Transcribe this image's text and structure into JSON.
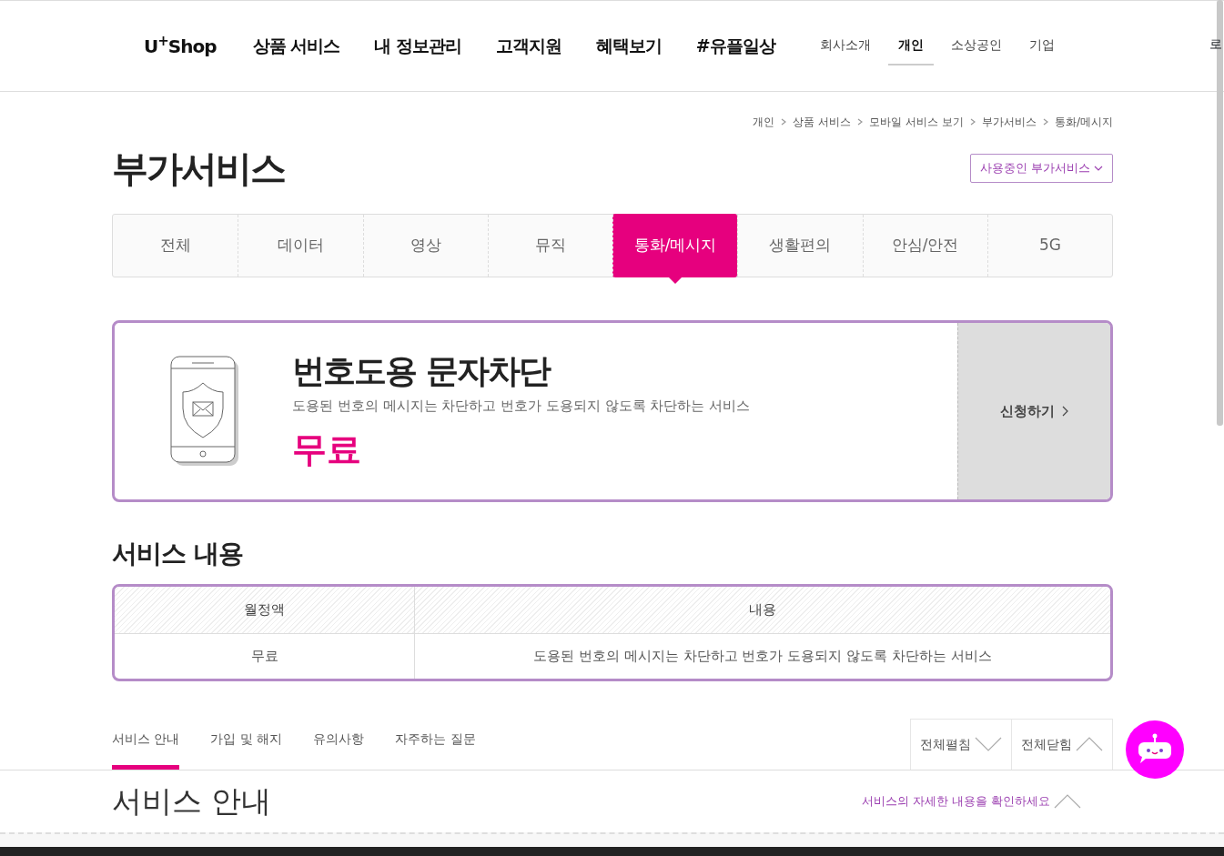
{
  "header": {
    "logo": "U$^{+}$Shop",
    "main_nav": [
      "상품 서비스",
      "내 정보관리",
      "고객지원",
      "혜택보기",
      "#유플일상"
    ],
    "sub_nav": [
      {
        "label": "회사소개",
        "selected": false
      },
      {
        "label": "개인",
        "selected": true
      },
      {
        "label": "소상공인",
        "selected": false
      },
      {
        "label": "기업",
        "selected": false
      }
    ],
    "cut_link": "로"
  },
  "breadcrumb": [
    "개인",
    "상품 서비스",
    "모바일 서비스 보기",
    "부가서비스",
    "통화/메시지"
  ],
  "page_title": "부가서비스",
  "in_use_button": "사용중인 부가서비스",
  "category_tabs": [
    {
      "label": "전체",
      "selected": false
    },
    {
      "label": "데이터",
      "selected": false
    },
    {
      "label": "영상",
      "selected": false
    },
    {
      "label": "뮤직",
      "selected": false
    },
    {
      "label": "통화/메시지",
      "selected": true
    },
    {
      "label": "생활편의",
      "selected": false
    },
    {
      "label": "안심/안전",
      "selected": false
    },
    {
      "label": "5G",
      "selected": false
    }
  ],
  "service": {
    "name": "번호도용 문자차단",
    "description": "도용된 번호의 메시지는 차단하고 번호가 도용되지 않도록 차단하는 서비스",
    "price": "무료",
    "apply_button": "신청하기"
  },
  "service_content": {
    "title": "서비스 내용",
    "columns": [
      "월정액",
      "내용"
    ],
    "rows": [
      [
        "무료",
        "도용된 번호의 메시지는 차단하고 번호가 도용되지 않도록 차단하는 서비스"
      ]
    ]
  },
  "detail_tabs": [
    {
      "label": "서비스 안내",
      "selected": true
    },
    {
      "label": "가입 및 해지",
      "selected": false
    },
    {
      "label": "유의사항",
      "selected": false
    },
    {
      "label": "자주하는 질문",
      "selected": false
    }
  ],
  "expand_all": "전체펼침",
  "collapse_all": "전체닫힘",
  "section": {
    "title": "서비스 안내",
    "hint": "서비스의 자세한 내용을 확인하세요"
  }
}
